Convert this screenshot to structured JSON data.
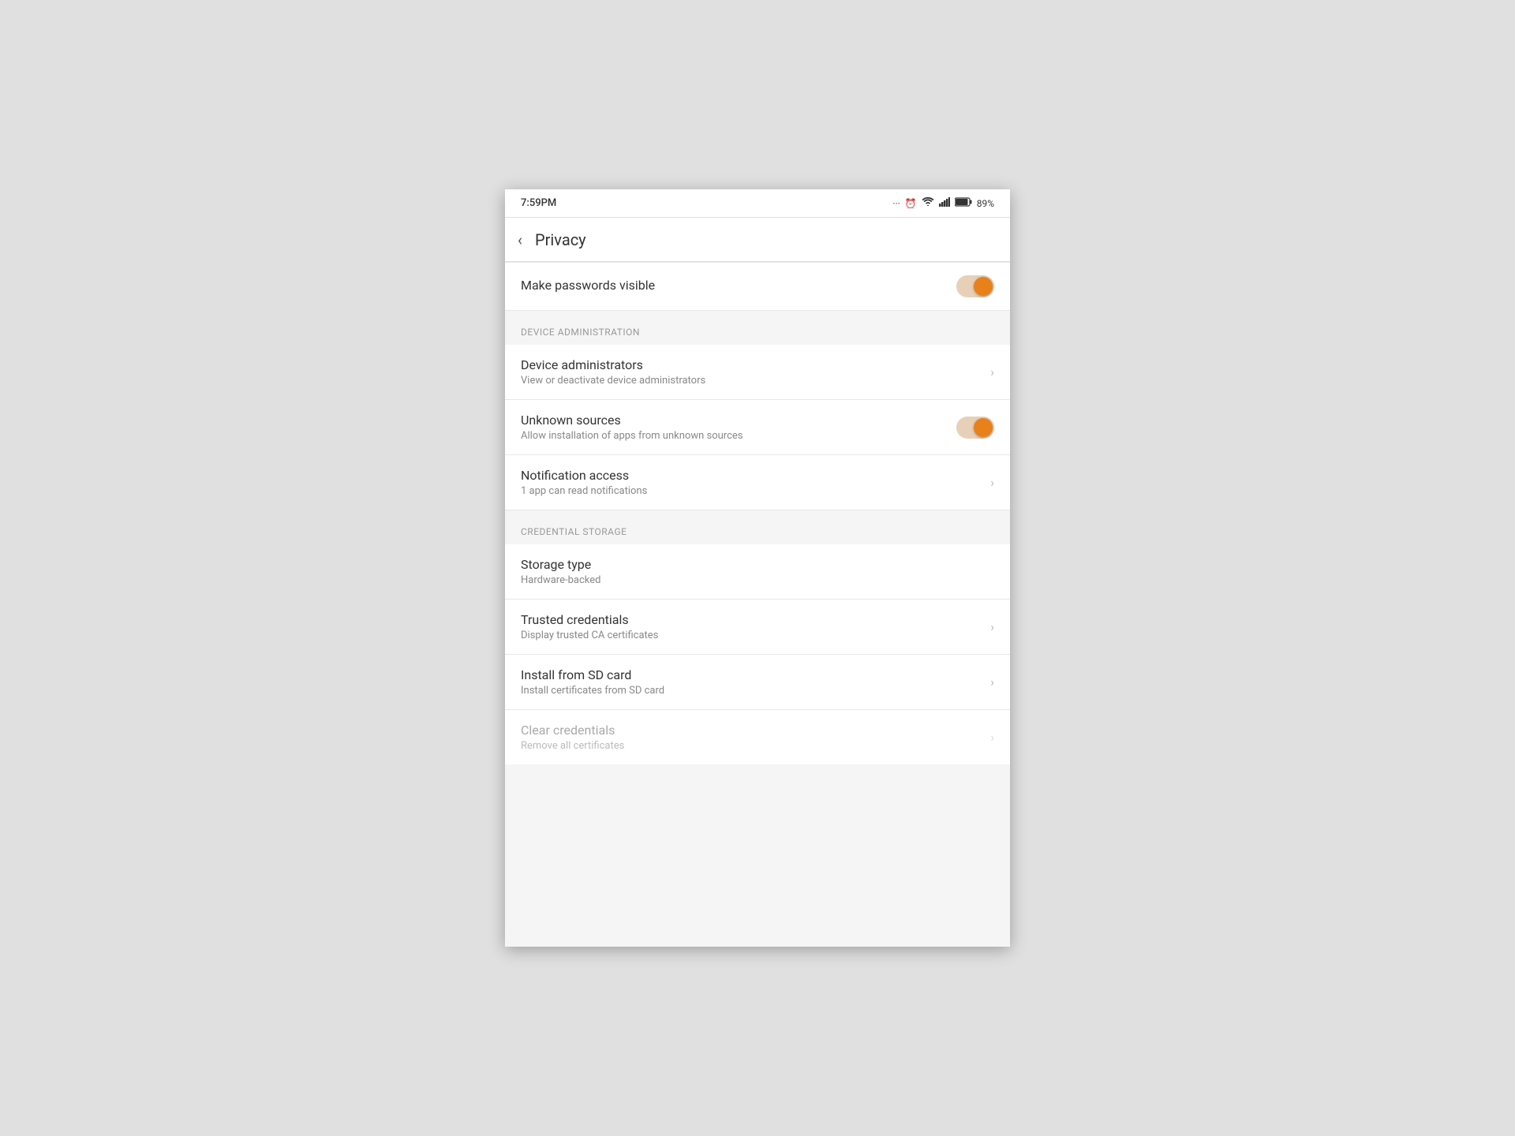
{
  "statusBar": {
    "time": "7:59PM",
    "battery": "89%",
    "icons": [
      "···",
      "⏰",
      "WiFi",
      "Signal",
      "🔋"
    ]
  },
  "header": {
    "backLabel": "‹",
    "title": "Privacy"
  },
  "topItem": {
    "label": "Make passwords visible",
    "toggleOn": true
  },
  "sections": [
    {
      "id": "device-administration",
      "headerLabel": "DEVICE ADMINISTRATION",
      "items": [
        {
          "id": "device-administrators",
          "title": "Device administrators",
          "subtitle": "View or deactivate device administrators",
          "type": "chevron",
          "disabled": false
        },
        {
          "id": "unknown-sources",
          "title": "Unknown sources",
          "subtitle": "Allow installation of apps from unknown sources",
          "type": "toggle",
          "toggleOn": true,
          "disabled": false
        },
        {
          "id": "notification-access",
          "title": "Notification access",
          "subtitle": "1 app can read notifications",
          "type": "chevron",
          "disabled": false
        }
      ]
    },
    {
      "id": "credential-storage",
      "headerLabel": "CREDENTIAL STORAGE",
      "items": [
        {
          "id": "storage-type",
          "title": "Storage type",
          "subtitle": "Hardware-backed",
          "type": "none",
          "disabled": false
        },
        {
          "id": "trusted-credentials",
          "title": "Trusted credentials",
          "subtitle": "Display trusted CA certificates",
          "type": "chevron",
          "disabled": false
        },
        {
          "id": "install-from-sd",
          "title": "Install from SD card",
          "subtitle": "Install certificates from SD card",
          "type": "chevron",
          "disabled": false
        },
        {
          "id": "clear-credentials",
          "title": "Clear credentials",
          "subtitle": "Remove all certificates",
          "type": "chevron",
          "disabled": true
        }
      ]
    }
  ]
}
